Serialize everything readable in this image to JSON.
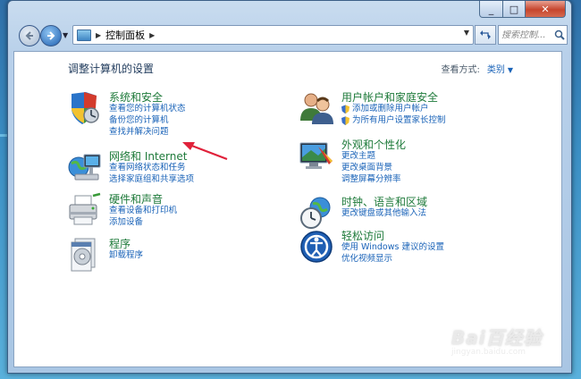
{
  "titlebar": {
    "minimize": "_",
    "maximize": "□",
    "close": "✕"
  },
  "toolbar": {
    "address_crumb": "控制面板",
    "search_placeholder": "搜索控制...",
    "search_icon": "search-icon"
  },
  "header": {
    "title": "调整计算机的设置",
    "view_by_label": "查看方式:",
    "view_by_value": "类别"
  },
  "categories": [
    {
      "title": "系统和安全",
      "links": [
        "查看您的计算机状态",
        "备份您的计算机",
        "查找并解决问题"
      ]
    },
    {
      "title": "网络和 Internet",
      "links": [
        "查看网络状态和任务",
        "选择家庭组和共享选项"
      ]
    },
    {
      "title": "硬件和声音",
      "links": [
        "查看设备和打印机",
        "添加设备"
      ]
    },
    {
      "title": "程序",
      "links": [
        "卸载程序"
      ]
    },
    {
      "title": "用户帐户和家庭安全",
      "links": [
        "添加或删除用户帐户",
        "为所有用户设置家长控制"
      ]
    },
    {
      "title": "外观和个性化",
      "links": [
        "更改主题",
        "更改桌面背景",
        "调整屏幕分辨率"
      ]
    },
    {
      "title": "时钟、语言和区域",
      "links": [
        "更改键盘或其他输入法"
      ]
    },
    {
      "title": "轻松访问",
      "links": [
        "使用 Windows 建议的设置",
        "优化视频显示"
      ]
    }
  ],
  "watermark": {
    "brand": "Bai百经验",
    "url": "jingyan.baidu.com"
  },
  "colors": {
    "category_title": "#1e7a3a",
    "link": "#1a63b8",
    "annotation_arrow": "#e0213a"
  }
}
